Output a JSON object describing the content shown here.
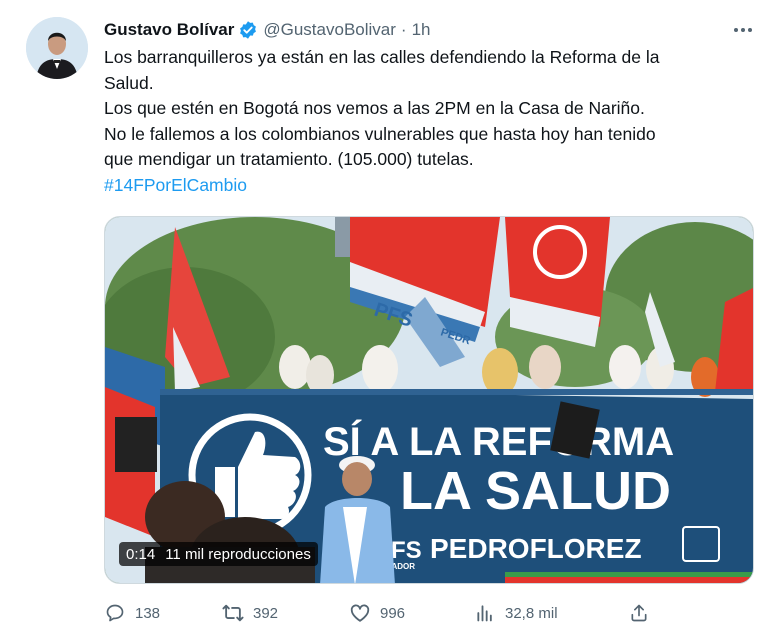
{
  "author": {
    "name": "Gustavo Bolívar",
    "handle": "@GustavoBolivar",
    "separator": "·",
    "time": "1h",
    "verified": true
  },
  "tweet": {
    "lines": [
      "Los barranquilleros ya están en las calles defendiendo la Reforma de la",
      "Salud.",
      "Los que estén en Bogotá nos vemos a las 2PM en la Casa de Nariño.",
      "No le fallemos a los colombianos vulnerables que hasta hoy han tenido",
      "que mendigar un tratamiento. (105.000) tutelas."
    ],
    "hashtag": "#14FPorElCambio"
  },
  "media": {
    "banner_line1": "SÍ A LA REFORMA",
    "banner_line2": "LA SALUD",
    "banner_brand_prefix": "PFS",
    "banner_brand_sub": "SENADOR",
    "banner_brand_name": "PEDROFLOREZ",
    "flag_text": "PFS",
    "flag_sub": "PEDR",
    "colors": {
      "banner": "#1e4f7a",
      "flag_red": "#e3342c",
      "sky": "#d9e6ef",
      "foliage": "#5f8a4a"
    }
  },
  "video": {
    "duration": "0:14",
    "views": "11 mil reproducciones"
  },
  "actions": {
    "replies": "138",
    "retweets": "392",
    "likes": "996",
    "views": "32,8 mil",
    "share_icon": "share-icon"
  },
  "icons": [
    "verified-badge-icon",
    "more-options-icon",
    "reply-icon",
    "retweet-icon",
    "like-icon",
    "views-icon",
    "share-icon"
  ],
  "accent": "#1d9bf0"
}
